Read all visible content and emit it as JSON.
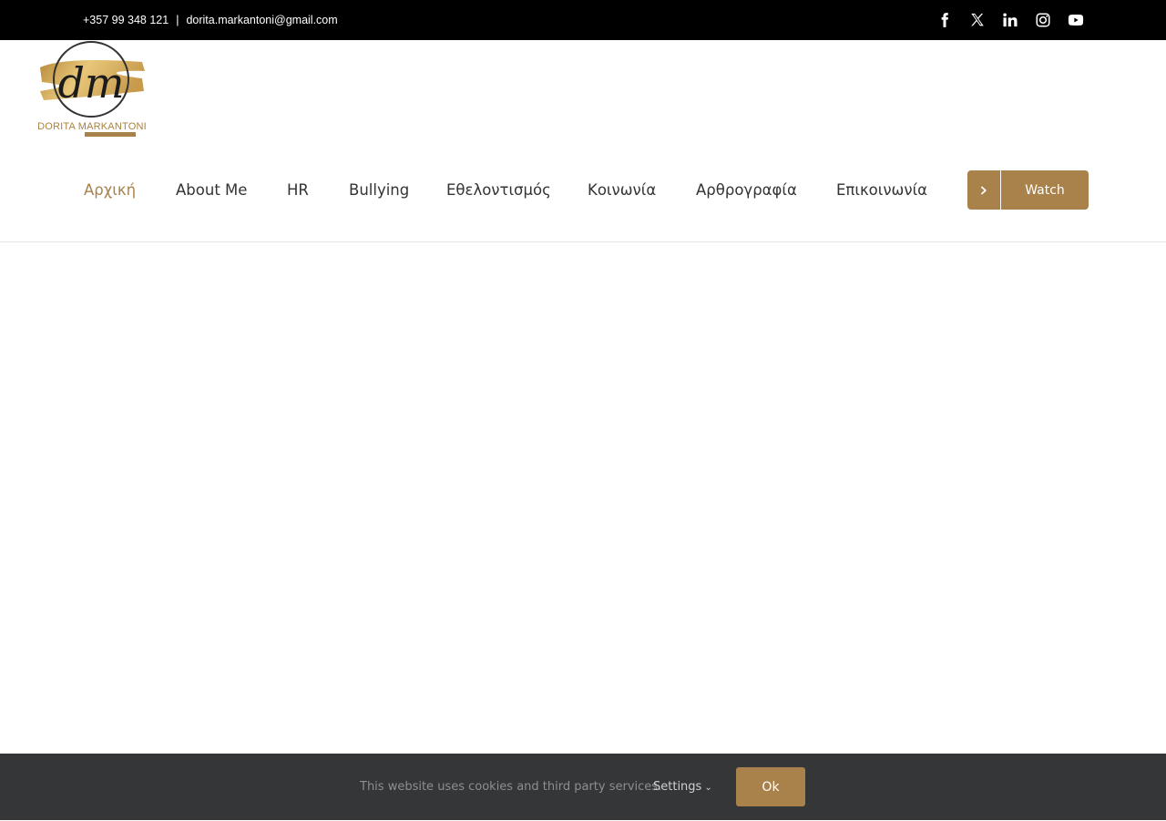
{
  "topbar": {
    "phone": "+357 99 348 121",
    "separator": "|",
    "email": "dorita.markantoni@gmail.com",
    "social": [
      "facebook-icon",
      "x-twitter-icon",
      "linkedin-icon",
      "instagram-icon",
      "youtube-icon"
    ]
  },
  "logo": {
    "monogram": "dm",
    "name": "DORITA MARKANTONI"
  },
  "nav": {
    "items": [
      {
        "label": "Αρχική",
        "active": true
      },
      {
        "label": "About Me"
      },
      {
        "label": "HR"
      },
      {
        "label": "Bullying"
      },
      {
        "label": "Εθελοντισμός"
      },
      {
        "label": "Κοινωνία"
      },
      {
        "label": "Αρθρογραφία"
      },
      {
        "label": "Επικοινωνία"
      }
    ],
    "button_label": "Watch"
  },
  "cookie": {
    "message": "This website uses cookies and third party services.",
    "settings_label": "Settings",
    "ok_label": "Ok"
  },
  "colors": {
    "accent": "#a9824b",
    "topbar_bg": "#000000",
    "cookie_bg": "#353637"
  }
}
